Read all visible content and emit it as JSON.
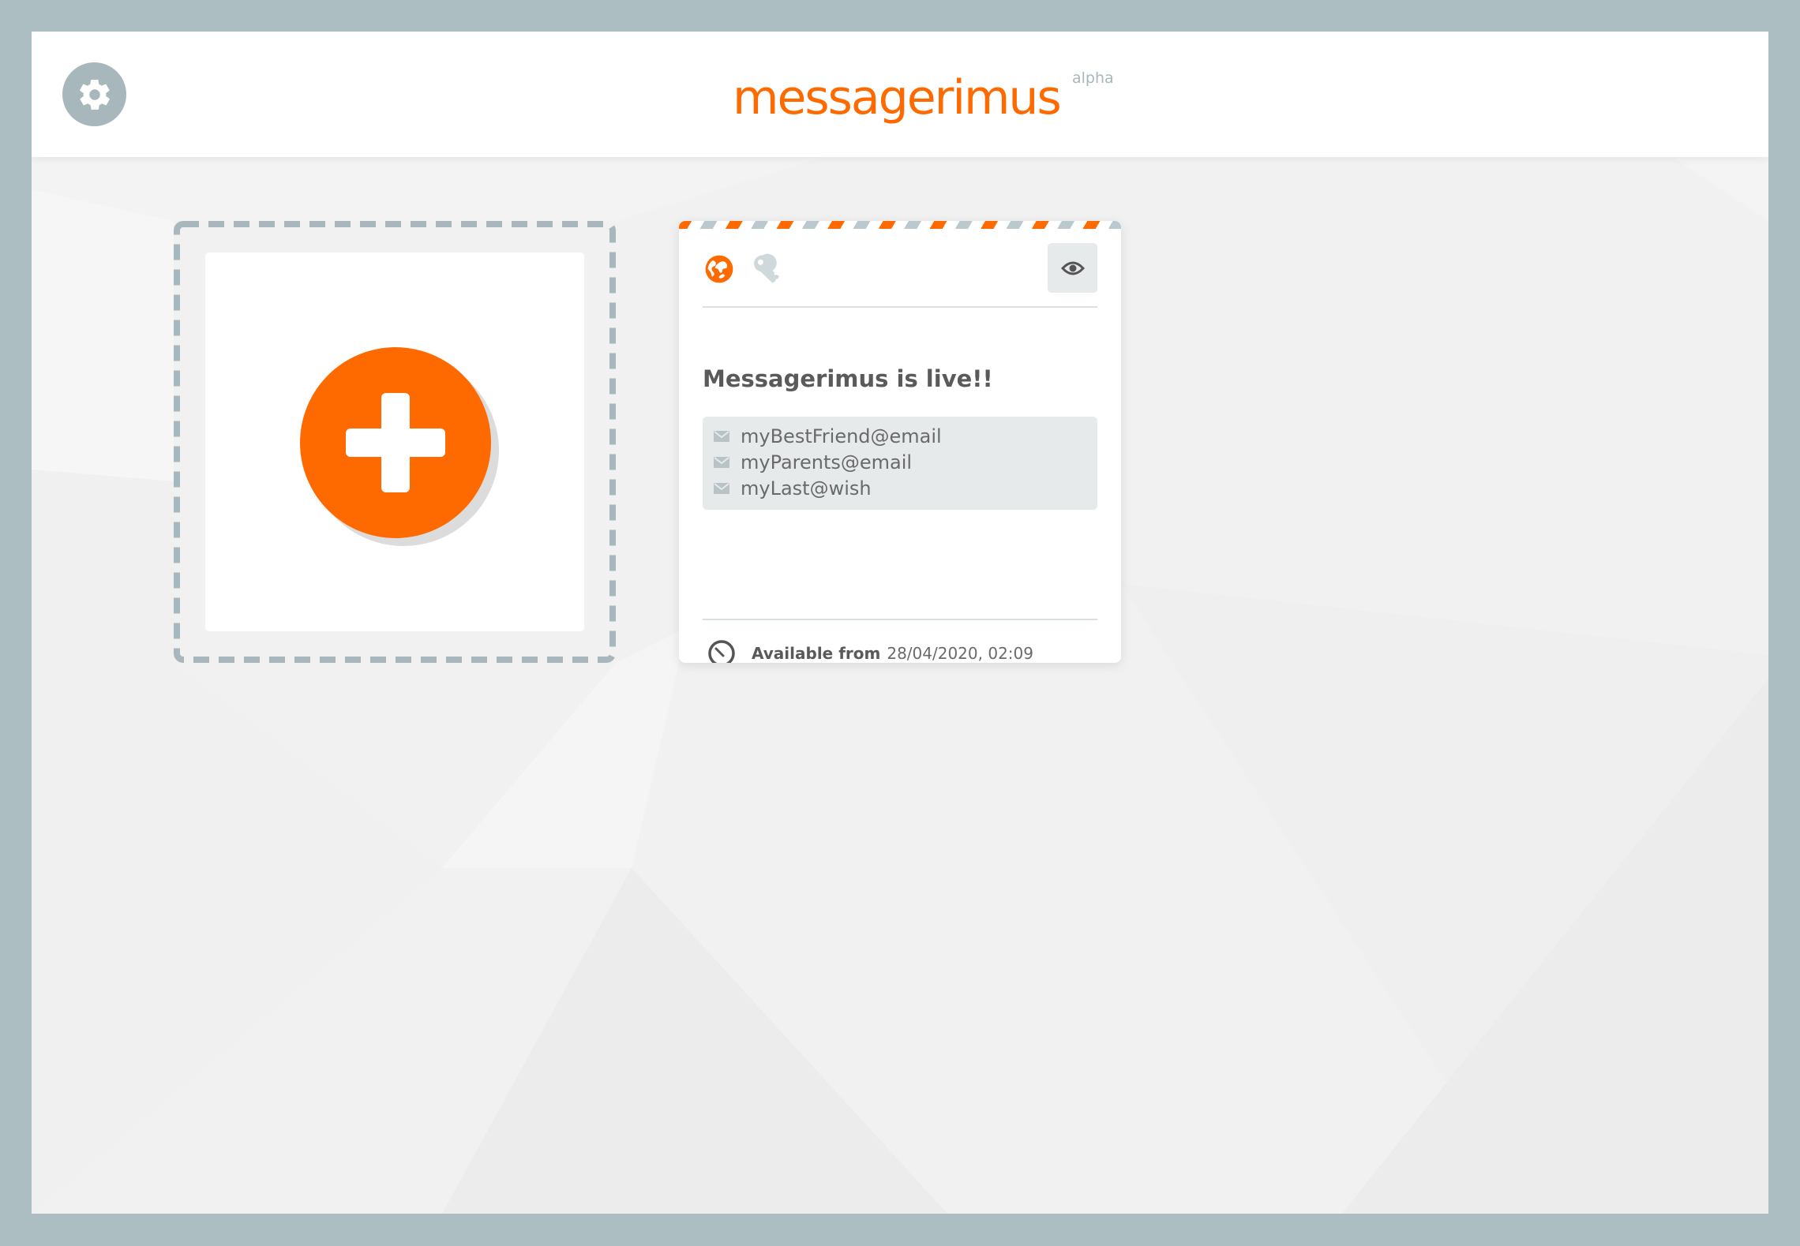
{
  "header": {
    "brand_name": "messagerimus",
    "brand_tag": "alpha",
    "settings_icon": "gear-icon"
  },
  "colors": {
    "accent": "#ff6a00",
    "frame": "#adbec2",
    "muted": "#a8b7bc"
  },
  "add_message": {
    "icon": "plus-icon"
  },
  "message_card": {
    "icons": [
      "globe-icon",
      "key-icon",
      "eye-icon"
    ],
    "title": "Messagerimus is live!!",
    "recipients": [
      "myBestFriend@email",
      "myParents@email",
      "myLast@wish"
    ],
    "available_label": "Available from",
    "available_value": "28/04/2020, 02:09"
  }
}
